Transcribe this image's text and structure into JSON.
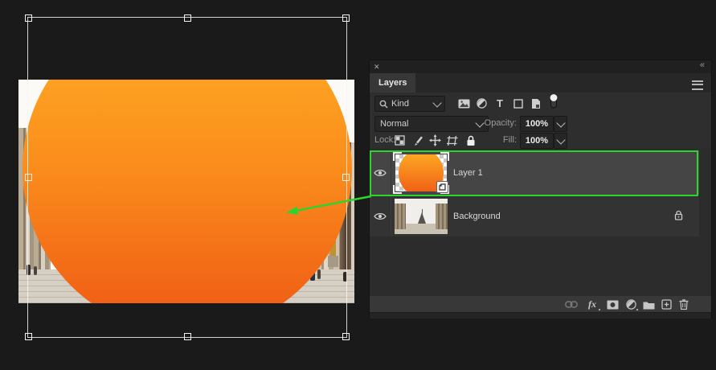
{
  "colors": {
    "annotation_green": "#2fd32f",
    "circle_gradient_top": "#ffb125",
    "circle_gradient_bottom": "#ee5714",
    "panel_background": "#2e2e2e",
    "selected_row": "#454545",
    "workspace_background": "#1a1a1a"
  },
  "panel": {
    "close_glyph": "✕",
    "collapse_glyph": "«",
    "tab_label": "Layers",
    "filter_row": {
      "kind_label": "Kind",
      "type_icon_glyph": "T"
    },
    "blend_row": {
      "mode_value": "Normal",
      "opacity_label": "Opacity:",
      "opacity_value": "100%"
    },
    "lock_row": {
      "lock_label": "Lock:",
      "fill_label": "Fill:",
      "fill_value": "100%"
    },
    "layers": [
      {
        "name": "Layer 1",
        "selected": true,
        "type": "smart-object",
        "visible": true
      },
      {
        "name": "Background",
        "selected": false,
        "locked": true,
        "visible": true
      }
    ],
    "footer": {
      "fx_label": "fx"
    }
  },
  "icons": {
    "search-icon": "magnifier",
    "pixel-layer-filter-icon": "image",
    "adjustment-layer-filter-icon": "half-filled-circle",
    "type-layer-filter-icon": "letter-T",
    "shape-layer-filter-icon": "hollow-square",
    "smart-object-filter-icon": "document",
    "filter-toggle-icon": "switch-pill",
    "lock-transparency-icon": "checkerboard",
    "lock-image-icon": "brush",
    "lock-position-icon": "move-cross",
    "lock-artboard-icon": "crop-frame",
    "lock-all-icon": "padlock",
    "eye-icon": "visibility-eye",
    "link-layers-icon": "chain",
    "layer-effects-icon": "fx",
    "layer-mask-icon": "rect-with-circle",
    "adjustment-layer-icon": "half-filled-circle",
    "new-group-icon": "folder",
    "new-layer-icon": "plus-square",
    "delete-layer-icon": "trash"
  }
}
